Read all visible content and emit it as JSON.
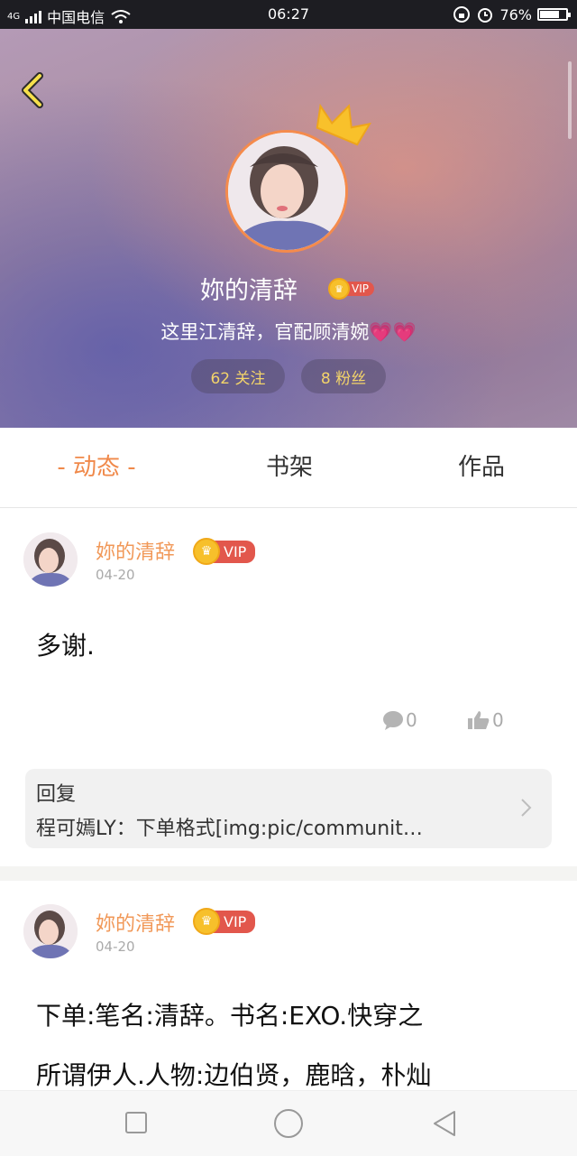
{
  "status": {
    "carrier": "中国电信",
    "network": "4G",
    "time": "06:27",
    "battery_label": "76%",
    "battery_level": 0.76
  },
  "profile": {
    "name": "妳的清辞",
    "vip_label": "VIP",
    "bio": "这里江清辞，官配顾清婉💗💗",
    "following": "62 关注",
    "followers": "8 粉丝"
  },
  "tabs": [
    {
      "label": "- 动态 -",
      "active": true
    },
    {
      "label": "书架",
      "active": false
    },
    {
      "label": "作品",
      "active": false
    }
  ],
  "posts": [
    {
      "author": "妳的清辞",
      "vip_label": "VIP",
      "date": "04-20",
      "text": "多谢.",
      "comments": "0",
      "likes": "0",
      "reply_title": "回复",
      "reply_text": "程可嫣LY：下单格式[img:pic/communit…"
    },
    {
      "author": "妳的清辞",
      "vip_label": "VIP",
      "date": "04-20",
      "text_line1": "下单:笔名:清辞。书名:EXO.快穿之",
      "text_line2": "所谓伊人.人物:边伯贤，鹿晗，朴灿"
    }
  ],
  "colors": {
    "accent": "#f0894a",
    "vip_red": "#e2574c",
    "gold": "#f7c02b",
    "count_text": "#f3d46a"
  },
  "icons": [
    "back-arrow-icon",
    "crown-icon",
    "comment-icon",
    "thumbs-up-icon",
    "chevron-right-icon",
    "square-nav-icon",
    "circle-nav-icon",
    "triangle-back-nav-icon"
  ]
}
